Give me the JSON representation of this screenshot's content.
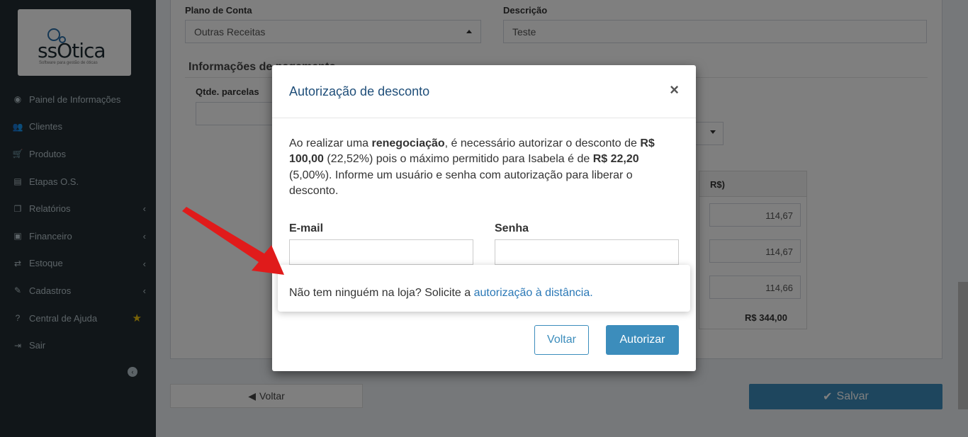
{
  "logo": {
    "name": "ssOtica",
    "tagline": "Software para gestão de óticas"
  },
  "sidebar": {
    "items": [
      {
        "label": "Painel de Informações",
        "icon": "dashboard-icon"
      },
      {
        "label": "Clientes",
        "icon": "users-icon"
      },
      {
        "label": "Produtos",
        "icon": "cart-icon"
      },
      {
        "label": "Etapas O.S.",
        "icon": "tasks-icon"
      },
      {
        "label": "Relatórios",
        "icon": "copy-icon",
        "chevron": true
      },
      {
        "label": "Financeiro",
        "icon": "money-icon",
        "chevron": true
      },
      {
        "label": "Estoque",
        "icon": "exchange-icon",
        "chevron": true
      },
      {
        "label": "Cadastros",
        "icon": "edit-icon",
        "chevron": true
      },
      {
        "label": "Central de Ajuda",
        "icon": "question-icon",
        "star": true
      },
      {
        "label": "Sair",
        "icon": "sign-out-icon"
      }
    ]
  },
  "form": {
    "plano_label": "Plano de Conta",
    "plano_value": "Outras Receitas",
    "descricao_label": "Descrição",
    "descricao_value": "Teste",
    "section_title": "Informações de pagamento",
    "qtde_label": "Qtde. parcelas",
    "valor_header": "R$)",
    "parcelas": [
      "114,67",
      "114,67",
      "114,66"
    ],
    "total": "R$ 344,00",
    "back_label": "Voltar",
    "save_label": "Salvar"
  },
  "modal": {
    "title": "Autorização de desconto",
    "close": "×",
    "msg_p1": "Ao realizar uma ",
    "msg_b1": "renegociação",
    "msg_p2": ", é necessário autorizar o desconto de ",
    "msg_b2": "R$ 100,00",
    "msg_p3": " (22,52%) pois o máximo permitido para Isabela é de ",
    "msg_b3": "R$ 22,20",
    "msg_p4": " (5,00%). Informe um usuário e senha com autorização para liberar o desconto.",
    "email_label": "E-mail",
    "senha_label": "Senha",
    "voltar_label": "Voltar",
    "autorizar_label": "Autorizar"
  },
  "highlight": {
    "text": "Não tem ninguém na loja? Solicite a ",
    "link": "autorização à distância."
  },
  "colors": {
    "accent": "#3c8dbc",
    "sidebar_bg": "#222d32",
    "arrow": "#e01b1b",
    "star": "#f1c40f"
  }
}
